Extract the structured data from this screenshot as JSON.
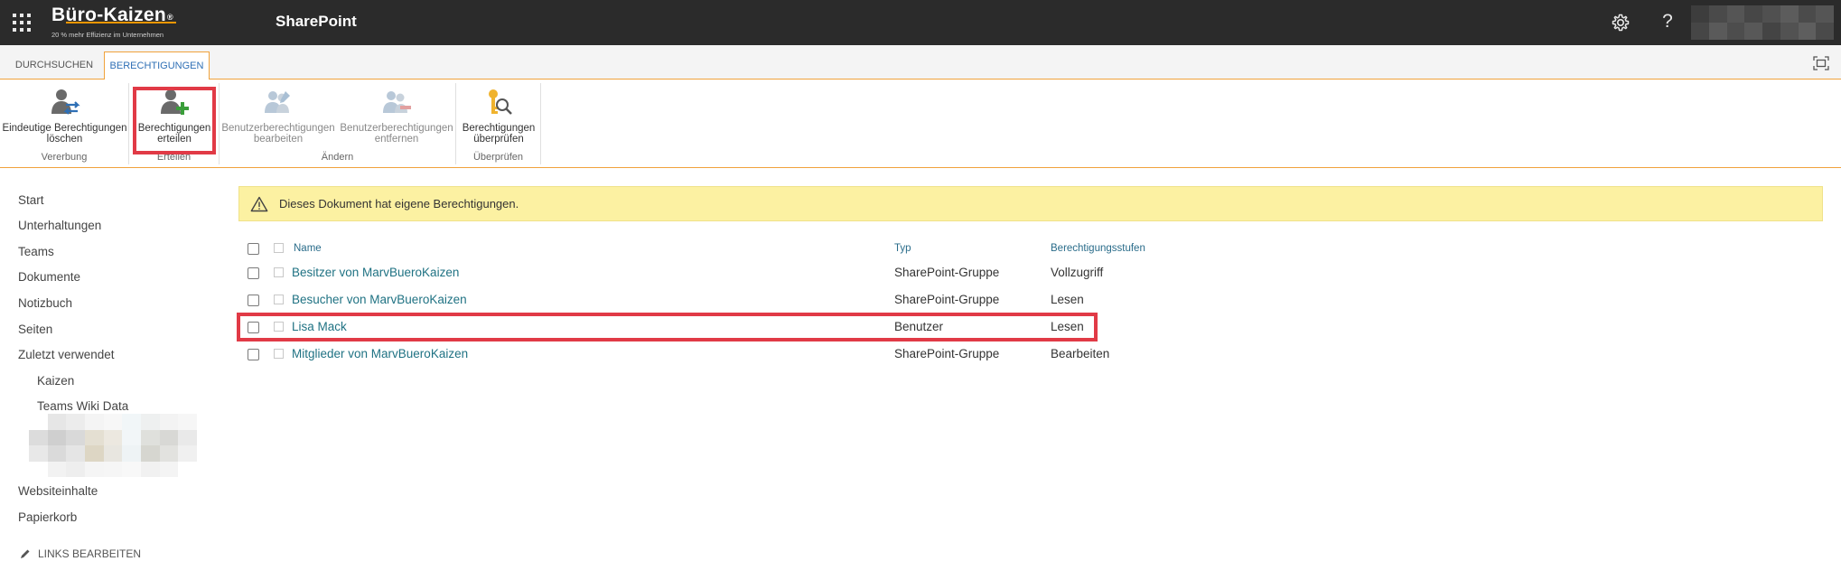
{
  "suite": {
    "brand_name": "Büro-Kaizen",
    "brand_reg": "®",
    "brand_slogan": "20 % mehr Effizienz im Unternehmen",
    "app_name": "SharePoint",
    "help_glyph": "?",
    "accent_color": "#f29600"
  },
  "tabs": [
    {
      "label": "DURCHSUCHEN"
    },
    {
      "label": "BERECHTIGUNGEN"
    }
  ],
  "ribbon": {
    "groups": [
      {
        "label": "Vererbung",
        "buttons": [
          {
            "line1": "Eindeutige Berechtigungen",
            "line2": "löschen",
            "icon": "delete-unique-permissions-icon"
          }
        ]
      },
      {
        "label": "Erteilen",
        "buttons": [
          {
            "line1": "Berechtigungen",
            "line2": "erteilen",
            "icon": "grant-permissions-icon"
          }
        ]
      },
      {
        "label": "Ändern",
        "buttons": [
          {
            "line1": "Benutzerberechtigungen",
            "line2": "bearbeiten",
            "icon": "edit-user-permissions-icon"
          },
          {
            "line1": "Benutzerberechtigungen",
            "line2": "entfernen",
            "icon": "remove-user-permissions-icon"
          }
        ]
      },
      {
        "label": "Überprüfen",
        "buttons": [
          {
            "line1": "Berechtigungen",
            "line2": "überprüfen",
            "icon": "check-permissions-icon"
          }
        ]
      }
    ]
  },
  "nav": {
    "items": [
      "Start",
      "Unterhaltungen",
      "Teams",
      "Dokumente",
      "Notizbuch",
      "Seiten",
      "Zuletzt verwendet"
    ],
    "sub_items": [
      "Kaizen",
      "Teams Wiki Data"
    ],
    "bottom_items": [
      "Websiteinhalte",
      "Papierkorb"
    ],
    "edit_links": "LINKS BEARBEITEN"
  },
  "warning": {
    "text": "Dieses Dokument hat eigene Berechtigungen."
  },
  "table": {
    "columns": [
      "Name",
      "Typ",
      "Berechtigungsstufen"
    ],
    "rows": [
      {
        "name": "Besitzer von MarvBueroKaizen",
        "type": "SharePoint-Gruppe",
        "level": "Vollzugriff"
      },
      {
        "name": "Besucher von MarvBueroKaizen",
        "type": "SharePoint-Gruppe",
        "level": "Lesen"
      },
      {
        "name": "Lisa Mack",
        "type": "Benutzer",
        "level": "Lesen"
      },
      {
        "name": "Mitglieder von MarvBueroKaizen",
        "type": "SharePoint-Gruppe",
        "level": "Bearbeiten"
      }
    ]
  }
}
